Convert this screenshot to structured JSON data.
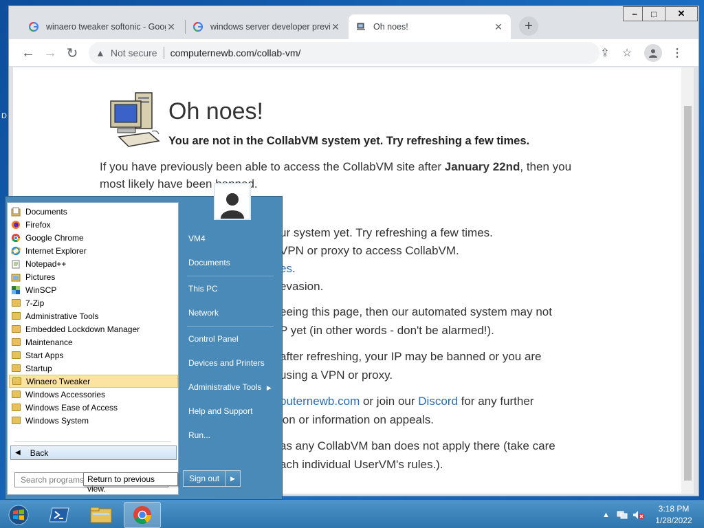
{
  "browser": {
    "tabs": [
      {
        "title": "winaero tweaker softonic - Goog",
        "active": false
      },
      {
        "title": "windows server developer previe",
        "active": false
      },
      {
        "title": "Oh noes!",
        "active": true
      }
    ],
    "new_tab_label": "+",
    "address": {
      "security_label": "Not secure",
      "url": "computernewb.com/collab-vm/"
    },
    "window_controls": {
      "minimize": "−",
      "maximize": "□",
      "close": "✕"
    }
  },
  "page": {
    "title": "Oh noes!",
    "subtitle": "You are not in the CollabVM system yet. Try refreshing a few times.",
    "para1_a": "If you have previously been able to access the CollabVM site after ",
    "para1_bold": "January 22nd",
    "para1_b": ", then you",
    "para1_line2": "most likely have been banned.",
    "frag_colon": ":",
    "frag1": "ur system yet. Try refreshing a few times.",
    "frag2": "VPN or proxy to access CollabVM.",
    "frag3_link": "es",
    "frag3_rest": ".",
    "frag4": "evasion.",
    "frag5": "eeing this page, then our automated system may not",
    "frag6": "P yet (in other words - don't be alarmed!).",
    "frag7": "after refreshing, your IP may be banned or you are",
    "frag8": "using a VPN or proxy.",
    "frag9_link": "puternewb.com",
    "frag9_mid": " or join our ",
    "frag9_link2": "Discord",
    "frag9_end": " for any further",
    "frag10": "ion or information on appeals.",
    "frag11": "as any CollabVM ban does not apply there (take care",
    "frag12": "ach individual UserVM's rules.)."
  },
  "start_menu": {
    "programs": [
      {
        "label": "Documents",
        "icon": "documents-icon"
      },
      {
        "label": "Firefox",
        "icon": "firefox-icon"
      },
      {
        "label": "Google Chrome",
        "icon": "chrome-icon"
      },
      {
        "label": "Internet Explorer",
        "icon": "ie-icon"
      },
      {
        "label": "Notepad++",
        "icon": "notepad-icon"
      },
      {
        "label": "Pictures",
        "icon": "pictures-icon"
      },
      {
        "label": "WinSCP",
        "icon": "winscp-icon"
      },
      {
        "label": "7-Zip",
        "icon": "folder-icon"
      },
      {
        "label": "Administrative Tools",
        "icon": "folder-icon"
      },
      {
        "label": "Embedded Lockdown Manager",
        "icon": "folder-icon"
      },
      {
        "label": "Maintenance",
        "icon": "folder-icon"
      },
      {
        "label": "Start Apps",
        "icon": "folder-icon"
      },
      {
        "label": "Startup",
        "icon": "folder-icon"
      },
      {
        "label": "Winaero Tweaker",
        "icon": "folder-icon",
        "highlighted": true
      },
      {
        "label": "Windows Accessories",
        "icon": "folder-icon"
      },
      {
        "label": "Windows Ease of Access",
        "icon": "folder-icon"
      },
      {
        "label": "Windows System",
        "icon": "folder-icon"
      }
    ],
    "back_label": "Back",
    "search_placeholder": "Search programs and files",
    "tooltip": "Return to previous view.",
    "right_items": {
      "vm4": "VM4",
      "documents": "Documents",
      "this_pc": "This PC",
      "network": "Network",
      "control_panel": "Control Panel",
      "devices": "Devices and Printers",
      "admin_tools": "Administrative Tools",
      "help": "Help and Support",
      "run": "Run..."
    },
    "sign_out": "Sign out"
  },
  "taskbar": {
    "clock_time": "3:18 PM",
    "clock_date": "1/28/2022"
  },
  "desktop": {
    "edge_letter": "D"
  }
}
